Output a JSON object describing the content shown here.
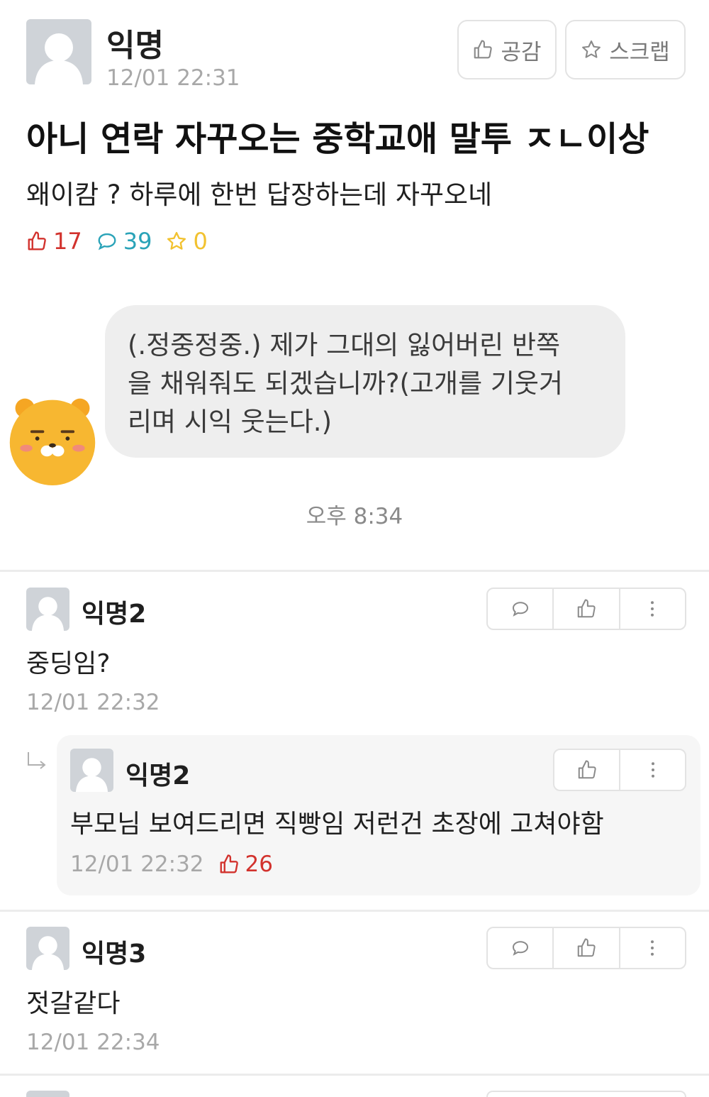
{
  "post": {
    "author": "익명",
    "time": "12/01 22:31",
    "like_button_label": "공감",
    "scrap_button_label": "스크랩",
    "title": "아니 연락 자꾸오는 중학교애 말투 ㅈㄴ이상",
    "body": "왜이캄 ? 하루에 한번 답장하는데 자꾸오네",
    "likes": "17",
    "comments": "39",
    "scraps": "0"
  },
  "chat": {
    "line1": "(.정중정중.) 제가 그대의 잃어버린 반쪽",
    "line2": "을 채워줘도 되겠습니까?(고개를 기웃거",
    "line3": "리며 시익 웃는다.)",
    "time": "오후 8:34"
  },
  "comments": [
    {
      "author": "익명2",
      "text": "중딩임?",
      "time": "12/01 22:32"
    },
    {
      "author": "익명3",
      "text": "젓갈같다",
      "time": "12/01 22:34"
    }
  ],
  "reply": {
    "author": "익명2",
    "text": "부모님 보여드리면 직빵임 저런건 초장에 고쳐야함",
    "time": "12/01 22:32",
    "likes": "26"
  },
  "colors": {
    "like_red": "#d2322d",
    "comment_teal": "#2aa3b8",
    "scrap_yellow": "#f2c230",
    "meta_gray": "#a8a8a8"
  }
}
